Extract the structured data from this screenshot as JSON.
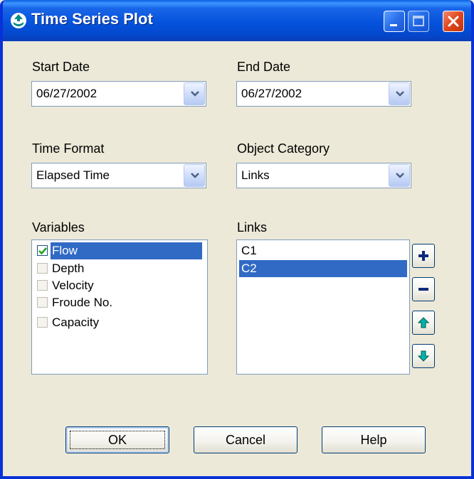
{
  "window": {
    "title": "Time Series Plot"
  },
  "start_date": {
    "label": "Start Date",
    "value": "06/27/2002"
  },
  "end_date": {
    "label": "End Date",
    "value": "06/27/2002"
  },
  "time_format": {
    "label": "Time Format",
    "value": "Elapsed Time"
  },
  "object_category": {
    "label": "Object Category",
    "value": "Links"
  },
  "variables": {
    "label": "Variables",
    "items": [
      {
        "label": "Flow",
        "checked": true,
        "selected": true
      },
      {
        "label": "Depth",
        "checked": false,
        "selected": false
      },
      {
        "label": "Velocity",
        "checked": false,
        "selected": false
      },
      {
        "label": "Froude No.",
        "checked": false,
        "selected": false
      },
      {
        "label": "Capacity",
        "checked": false,
        "selected": false
      }
    ]
  },
  "links": {
    "label": "Links",
    "items": [
      {
        "label": "C1",
        "selected": false
      },
      {
        "label": "C2",
        "selected": true
      }
    ]
  },
  "side_buttons": [
    "plus-icon",
    "minus-icon",
    "arrow-up-icon",
    "arrow-down-icon"
  ],
  "buttons": {
    "ok": "OK",
    "cancel": "Cancel",
    "help": "Help"
  },
  "colors": {
    "titlebar": "#0553dc",
    "selection": "#316ac5",
    "icon_accent": "#008a8a",
    "face": "#ece9d8"
  }
}
